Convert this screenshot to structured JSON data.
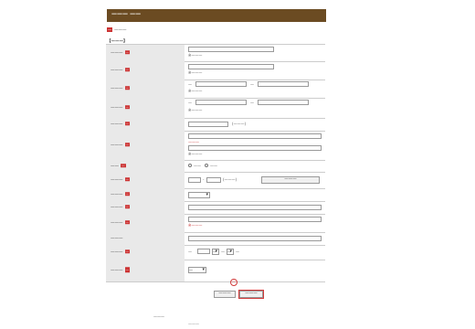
{
  "header": {
    "title": "———  ——"
  },
  "intro": {
    "required_badge": "—",
    "text": "———"
  },
  "section": {
    "title": "【———】"
  },
  "rows": {
    "password": {
      "label": "———",
      "badge": "—",
      "hint": "※———"
    },
    "password_confirm": {
      "label": "———",
      "badge": "—",
      "hint": "※———"
    },
    "name_kanji": {
      "label": "———",
      "badge": "—",
      "sei": "—",
      "mei": "—",
      "hint": "※———"
    },
    "name_kana": {
      "label": "———",
      "badge": "—",
      "sei": "—",
      "mei": "—",
      "hint": "※———"
    },
    "phone": {
      "label": "———",
      "badge": "—",
      "hint": "(———)"
    },
    "email": {
      "label": "———",
      "badge": "—",
      "warn": "———",
      "hint": "※———"
    },
    "gender": {
      "label": "——",
      "badge": "—",
      "male": "——",
      "female": "——"
    },
    "postal": {
      "label": "———",
      "badge": "—",
      "dash": "-",
      "hint": "(———)",
      "lookup_button": "———"
    },
    "prefecture": {
      "label": "———",
      "badge": "—"
    },
    "city": {
      "label": "———",
      "badge": "—"
    },
    "address": {
      "label": "———",
      "badge": "—",
      "hint": "※———"
    },
    "building": {
      "label": "———"
    },
    "birthday": {
      "label": "———",
      "badge": "—",
      "year_label": "—",
      "month_label": "—",
      "day_label": "—",
      "month_value": "—",
      "day_value": "—"
    },
    "newsletter": {
      "label": "———",
      "badge": "—",
      "value": "—"
    }
  },
  "buttons": {
    "clear": "———",
    "next": "———",
    "marker": "—"
  },
  "footer": {
    "links": "———",
    "copyright": "———"
  }
}
